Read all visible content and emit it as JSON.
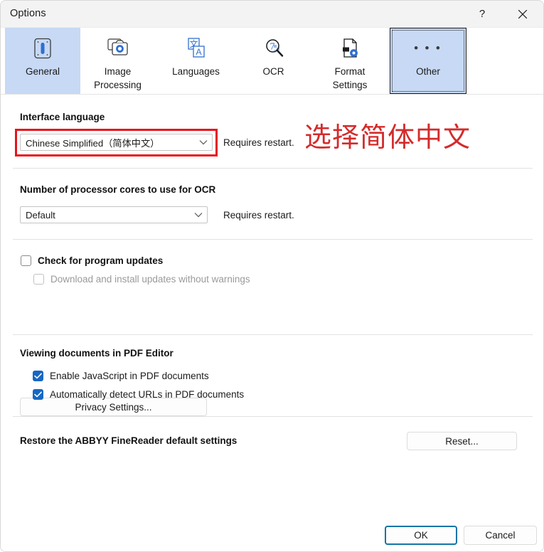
{
  "window": {
    "title": "Options",
    "help_label": "?",
    "close_label": "Close"
  },
  "tabs": [
    {
      "id": "general",
      "label": "General",
      "icon": "id-card-icon",
      "selected": true
    },
    {
      "id": "image",
      "label": "Image\nProcessing",
      "icon": "camera-icon",
      "selected": false
    },
    {
      "id": "lang",
      "label": "Languages",
      "icon": "translate-icon",
      "selected": false
    },
    {
      "id": "ocr",
      "label": "OCR",
      "icon": "magnifier-ocr-icon",
      "selected": false
    },
    {
      "id": "format",
      "label": "Format\nSettings",
      "icon": "document-gear-icon",
      "selected": false
    },
    {
      "id": "other",
      "label": "Other",
      "icon": "ellipsis-icon",
      "selected": true
    }
  ],
  "interface_language": {
    "heading": "Interface language",
    "selected": "Chinese Simplified（简体中文）",
    "restart_hint": "Requires restart."
  },
  "annotation": {
    "text": "选择简体中文",
    "color": "#d42b2b",
    "box_color": "#e8141b"
  },
  "processor_cores": {
    "heading": "Number of processor cores to use for OCR",
    "selected": "Default",
    "restart_hint": "Requires restart."
  },
  "updates": {
    "check_label": "Check for program updates",
    "check_checked": false,
    "auto_label": "Download and install updates without warnings",
    "auto_checked": false,
    "auto_disabled": true,
    "privacy_button": "Privacy Settings..."
  },
  "pdf_viewing": {
    "heading": "Viewing documents in PDF Editor",
    "javascript_label": "Enable JavaScript in PDF documents",
    "javascript_checked": true,
    "urls_label": "Automatically detect URLs in PDF documents",
    "urls_checked": true
  },
  "restore": {
    "heading": "Restore the ABBYY FineReader default settings",
    "reset_button": "Reset..."
  },
  "footer": {
    "ok_label": "OK",
    "cancel_label": "Cancel"
  }
}
